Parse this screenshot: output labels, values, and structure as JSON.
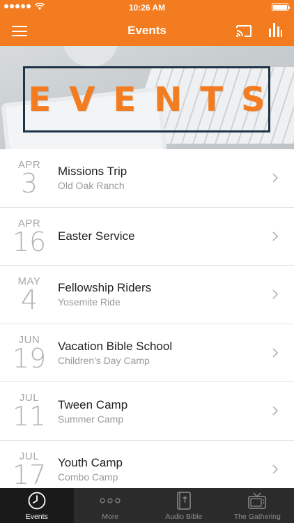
{
  "status_bar": {
    "time": "10:26 AM"
  },
  "nav": {
    "title": "Events",
    "icons": {
      "menu": "hamburger-menu-icon",
      "cast": "cast-icon",
      "stats": "bar-chart-icon"
    }
  },
  "hero": {
    "banner_text": "EVENTS",
    "accent_color": "#f47c20",
    "frame_color": "#1e3347"
  },
  "events": [
    {
      "month": "APR",
      "day": "3",
      "name": "Missions Trip",
      "place": "Old Oak Ranch"
    },
    {
      "month": "APR",
      "day": "16",
      "name": "Easter Service",
      "place": ""
    },
    {
      "month": "MAY",
      "day": "4",
      "name": "Fellowship Riders",
      "place": "Yosemite Ride"
    },
    {
      "month": "JUN",
      "day": "19",
      "name": "Vacation Bible School",
      "place": "Children's Day Camp"
    },
    {
      "month": "JUL",
      "day": "11",
      "name": "Tween Camp",
      "place": "Summer Camp"
    },
    {
      "month": "JUL",
      "day": "17",
      "name": "Youth Camp",
      "place": "Combo Camp"
    }
  ],
  "tabs": [
    {
      "label": "Events",
      "icon": "clock-icon",
      "active": true
    },
    {
      "label": "More",
      "icon": "more-dots-icon",
      "active": false
    },
    {
      "label": "Audio Bible",
      "icon": "bible-icon",
      "active": false
    },
    {
      "label": "The Gathering",
      "icon": "tv-icon",
      "active": false
    }
  ],
  "colors": {
    "brand": "#f47c20",
    "tab_bar": "#2b2b2b"
  }
}
